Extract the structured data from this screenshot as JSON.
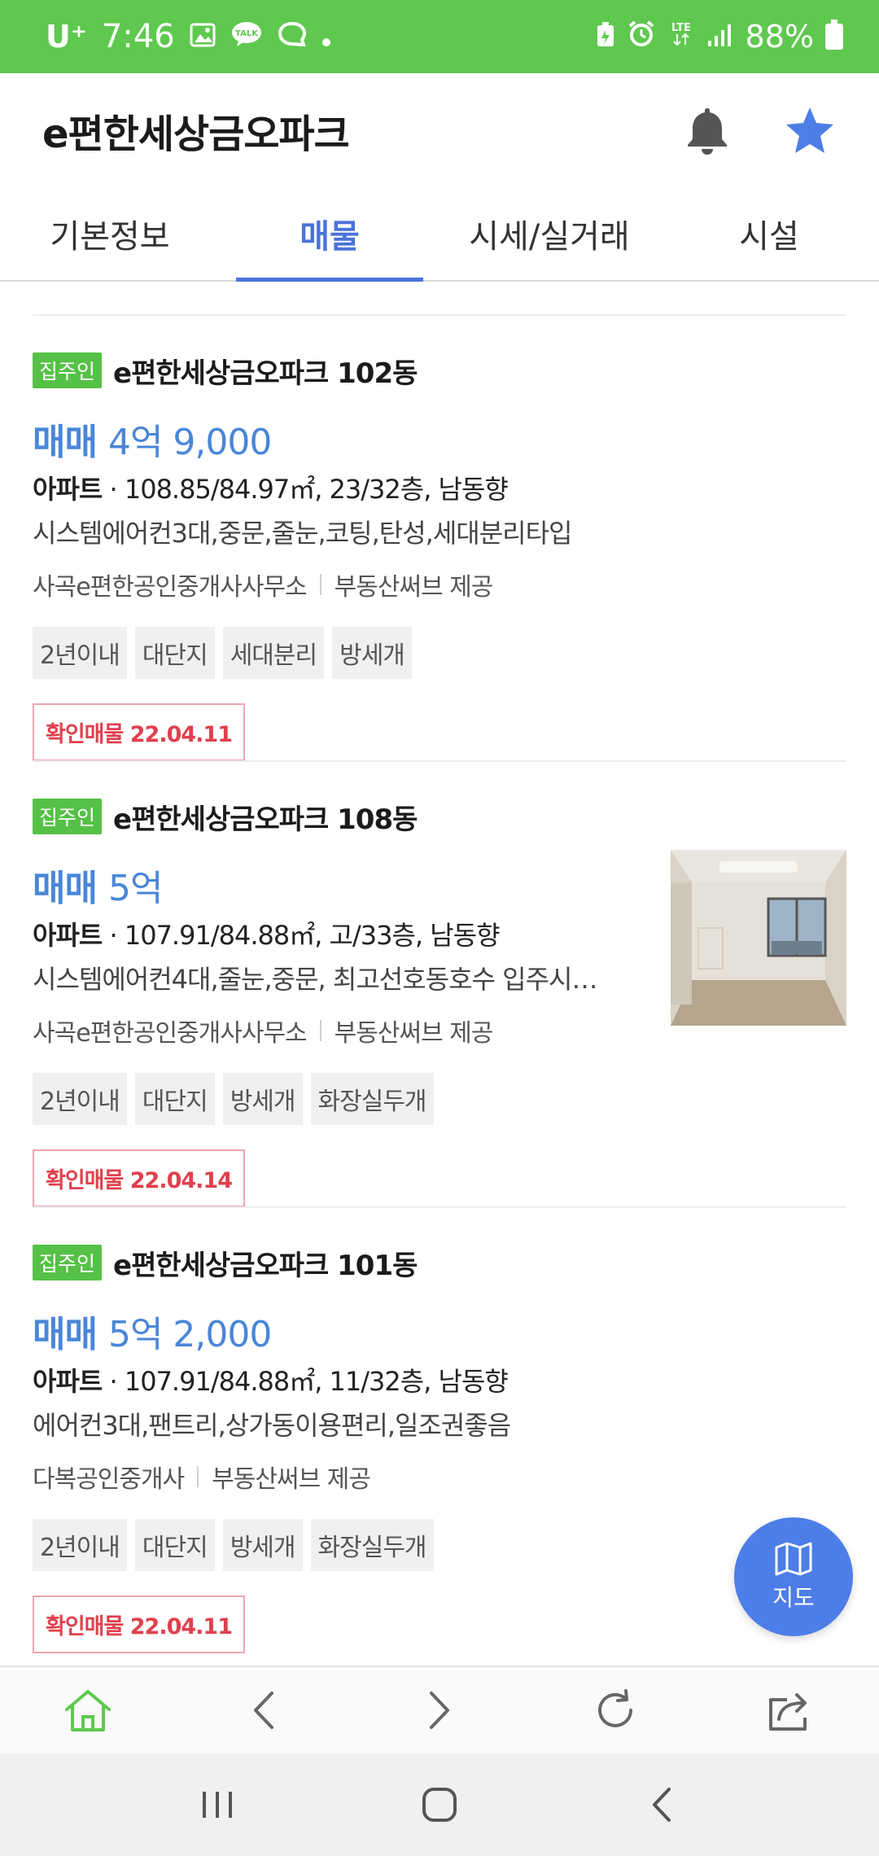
{
  "status_bar": {
    "carrier": "U⁺",
    "time": "7:46",
    "battery": "88%",
    "network": "LTE"
  },
  "header": {
    "title": "e편한세상금오파크"
  },
  "tabs": [
    {
      "label": "기본정보"
    },
    {
      "label": "매물"
    },
    {
      "label": "시세/실거래"
    },
    {
      "label": "시설"
    }
  ],
  "listings": [
    {
      "badge": "집주인",
      "complex": "e편한세상금오파크 102동",
      "price_type": "매매",
      "price": "4억 9,000",
      "prop_type": "아파트",
      "specs": "· 108.85/84.97㎡, 23/32층, 남동향",
      "desc": "시스템에어컨3대,중문,줄눈,코팅,탄성,세대분리타입",
      "agency": "사곡e편한공인중개사사무소",
      "provider": "부동산써브 제공",
      "tags": [
        "2년이내",
        "대단지",
        "세대분리",
        "방세개"
      ],
      "verified": "확인매물 22.04.11"
    },
    {
      "badge": "집주인",
      "complex": "e편한세상금오파크 108동",
      "price_type": "매매",
      "price": "5억",
      "prop_type": "아파트",
      "specs": "· 107.91/84.88㎡, 고/33층, 남동향",
      "desc": "시스템에어컨4대,줄눈,중문, 최고선호동호수 입주시…",
      "agency": "사곡e편한공인중개사사무소",
      "provider": "부동산써브 제공",
      "tags": [
        "2년이내",
        "대단지",
        "방세개",
        "화장실두개"
      ],
      "verified": "확인매물 22.04.14"
    },
    {
      "badge": "집주인",
      "complex": "e편한세상금오파크 101동",
      "price_type": "매매",
      "price": "5억 2,000",
      "prop_type": "아파트",
      "specs": "· 107.91/84.88㎡, 11/32층, 남동향",
      "desc": "에어컨3대,팬트리,상가동이용편리,일조권좋음",
      "agency": "다복공인중개사",
      "provider": "부동산써브 제공",
      "tags": [
        "2년이내",
        "대단지",
        "방세개",
        "화장실두개"
      ],
      "verified": "확인매물 22.04.11"
    }
  ],
  "map_button": {
    "label": "지도"
  },
  "colors": {
    "status_bar": "#5fc84f",
    "accent": "#4a73d9",
    "price": "#4a86d8",
    "badge": "#55c146",
    "verified": "#e0404e",
    "fab": "#4d7ee8"
  }
}
